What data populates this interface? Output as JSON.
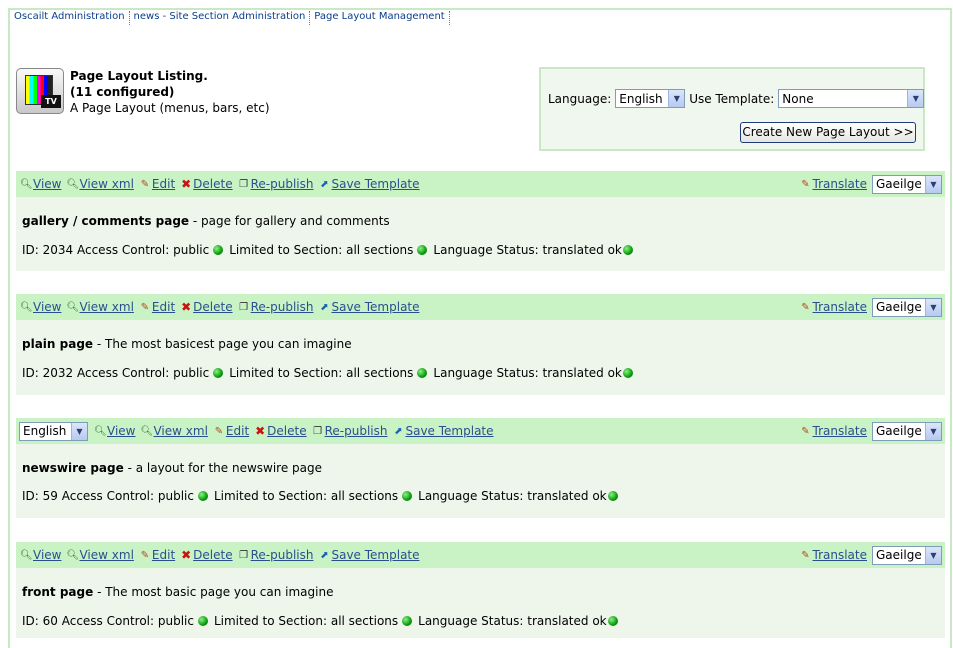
{
  "breadcrumb": [
    "Oscailt Administration",
    "news - Site Section Administration",
    "Page Layout Management"
  ],
  "header": {
    "icon_text": "TV",
    "title": "Page Layout Listing.",
    "count": "(11 configured)",
    "subtitle": "A Page Layout (menus, bars, etc)"
  },
  "language_panel": {
    "language_label": "Language:",
    "language_value": "English",
    "template_label": "Use Template:",
    "template_value": "None",
    "create_button": "Create New Page Layout >>"
  },
  "actions": {
    "view": "View",
    "view_xml": "View xml",
    "edit": "Edit",
    "delete": "Delete",
    "republish": "Re-publish",
    "save_template": "Save Template",
    "translate": "Translate",
    "translate_lang": "Gaeilge"
  },
  "entries": [
    {
      "name": "gallery / comments page",
      "desc": " - page for gallery and comments",
      "id_text": "ID: 2034 Access Control: public",
      "section_text": "Limited to Section: all sections",
      "lang_status": "Language Status: translated ok"
    },
    {
      "name": "plain page",
      "desc": " - The most basicest page you can imagine",
      "id_text": "ID: 2032 Access Control: public",
      "section_text": "Limited to Section: all sections",
      "lang_status": "Language Status: translated ok"
    },
    {
      "name": "newswire page",
      "desc": " - a layout for the newswire page",
      "id_text": "ID: 59 Access Control: public",
      "section_text": "Limited to Section: all sections",
      "lang_status": "Language Status: translated ok",
      "lang_select": "English"
    },
    {
      "name": "front page",
      "desc": " - The most basic page you can imagine",
      "id_text": "ID: 60 Access Control: public",
      "section_text": "Limited to Section: all sections",
      "lang_status": "Language Status: translated ok"
    }
  ],
  "colors": {
    "bar": "#c9f3c4",
    "entry_bg": "#eef6ec",
    "link": "#2a4f8f",
    "border": "#c9e8c6"
  }
}
